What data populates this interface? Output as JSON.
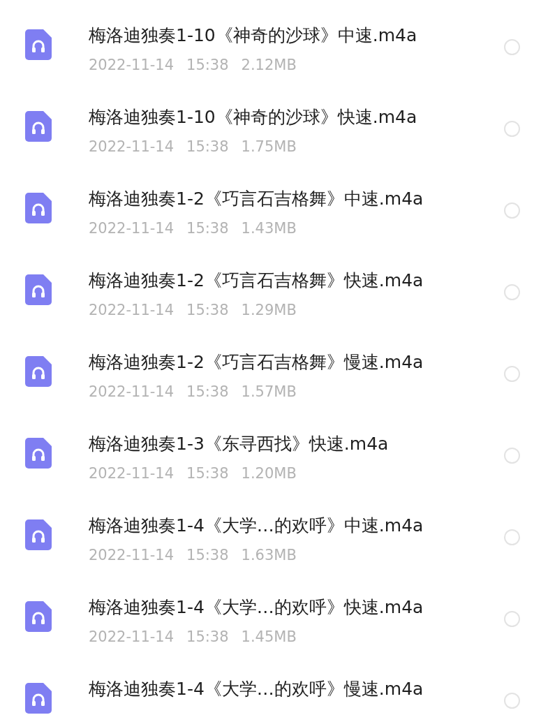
{
  "files": [
    {
      "name": "梅洛迪独奏1-10《神奇的沙球》中速.m4a",
      "date": "2022-11-14",
      "time": "15:38",
      "size": "2.12MB",
      "selected": false
    },
    {
      "name": "梅洛迪独奏1-10《神奇的沙球》快速.m4a",
      "date": "2022-11-14",
      "time": "15:38",
      "size": "1.75MB",
      "selected": false
    },
    {
      "name": "梅洛迪独奏1-2《巧言石吉格舞》中速.m4a",
      "date": "2022-11-14",
      "time": "15:38",
      "size": "1.43MB",
      "selected": false
    },
    {
      "name": "梅洛迪独奏1-2《巧言石吉格舞》快速.m4a",
      "date": "2022-11-14",
      "time": "15:38",
      "size": "1.29MB",
      "selected": false
    },
    {
      "name": "梅洛迪独奏1-2《巧言石吉格舞》慢速.m4a",
      "date": "2022-11-14",
      "time": "15:38",
      "size": "1.57MB",
      "selected": false
    },
    {
      "name": "梅洛迪独奏1-3《东寻西找》快速.m4a",
      "date": "2022-11-14",
      "time": "15:38",
      "size": "1.20MB",
      "selected": false
    },
    {
      "name": "梅洛迪独奏1-4《大学…的欢呼》中速.m4a",
      "date": "2022-11-14",
      "time": "15:38",
      "size": "1.63MB",
      "selected": false
    },
    {
      "name": "梅洛迪独奏1-4《大学…的欢呼》快速.m4a",
      "date": "2022-11-14",
      "time": "15:38",
      "size": "1.45MB",
      "selected": false
    },
    {
      "name": "梅洛迪独奏1-4《大学…的欢呼》慢速.m4a",
      "selected": false
    }
  ]
}
